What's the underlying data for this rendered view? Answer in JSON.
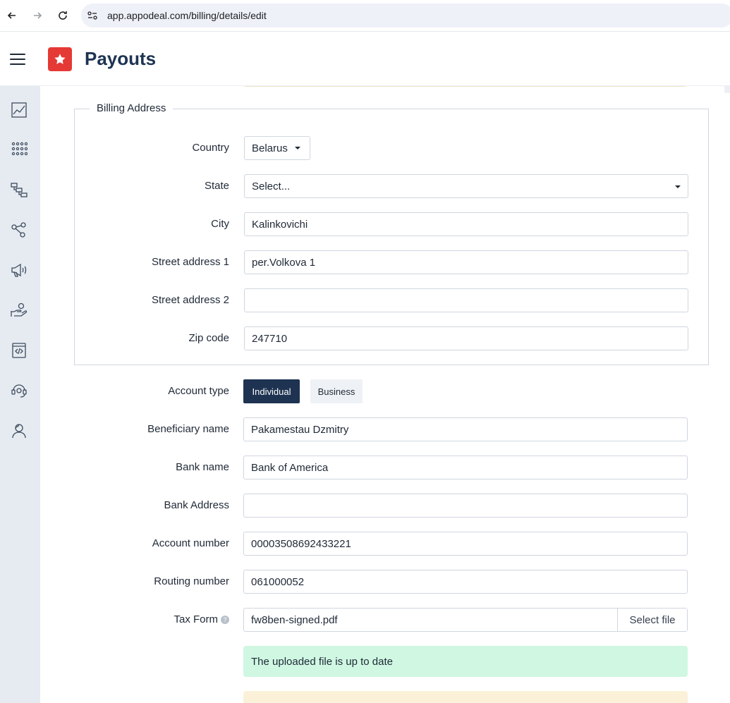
{
  "browser": {
    "url": "app.appodeal.com/billing/details/edit"
  },
  "header": {
    "title": "Payouts"
  },
  "billing_address": {
    "legend": "Billing Address",
    "country_label": "Country",
    "country_value": "Belarus",
    "state_label": "State",
    "state_value": "Select...",
    "city_label": "City",
    "city_value": "Kalinkovichi",
    "street1_label": "Street address 1",
    "street1_value": "per.Volkova 1",
    "street2_label": "Street address 2",
    "street2_value": "",
    "zip_label": "Zip code",
    "zip_value": "247710"
  },
  "account": {
    "type_label": "Account type",
    "type_options": [
      "Individual",
      "Business"
    ],
    "type_selected": "Individual",
    "beneficiary_label": "Beneficiary name",
    "beneficiary_value": "Pakamestau Dzmitry",
    "bank_name_label": "Bank name",
    "bank_name_value": "Bank of America",
    "bank_address_label": "Bank Address",
    "bank_address_value": "",
    "account_number_label": "Account number",
    "account_number_value": "00003508692433221",
    "routing_label": "Routing number",
    "routing_value": "061000052",
    "tax_form_label": "Tax Form",
    "tax_form_file": "fw8ben-signed.pdf",
    "select_file_label": "Select file",
    "upload_status": "The uploaded file is up to date"
  },
  "sidebar": {
    "icons": [
      "analytics-icon",
      "apps-grid-icon",
      "mediation-icon",
      "network-icon",
      "megaphone-icon",
      "payouts-hand-icon",
      "sdk-code-icon",
      "support-icon",
      "user-icon"
    ]
  },
  "colors": {
    "brand_navy": "#1e3352",
    "logo_red": "#e53935",
    "success_bg": "#cff7e2",
    "warning_bg": "#fbf1d9",
    "sidebar_bg": "#e6ebf2"
  }
}
